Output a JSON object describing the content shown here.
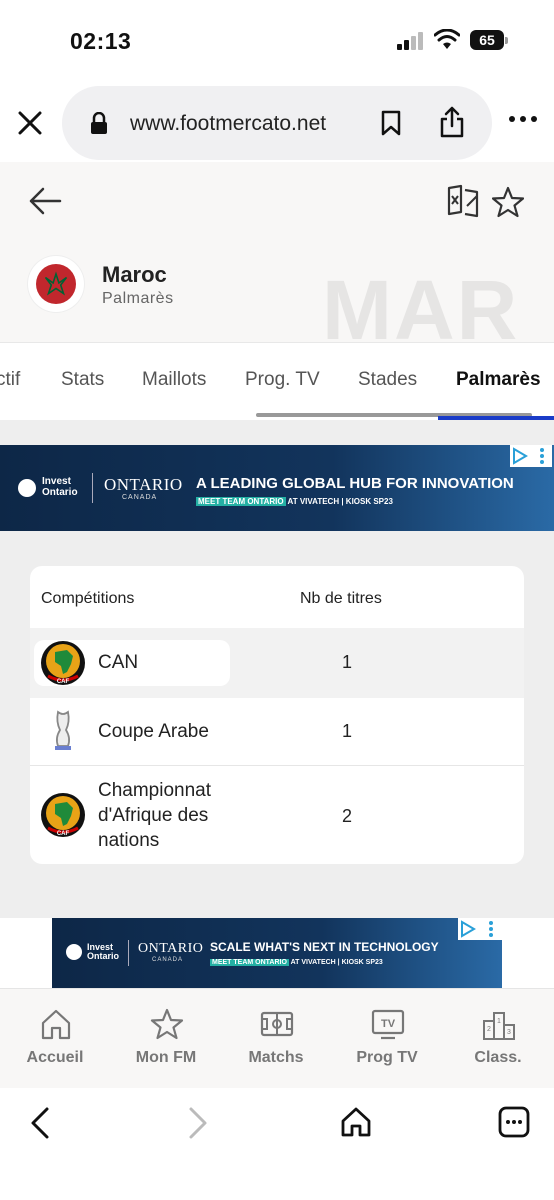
{
  "status_bar": {
    "time": "02:13",
    "battery": "65"
  },
  "browser": {
    "url": "www.footmercato.net"
  },
  "header": {
    "team_name": "Maroc",
    "subtitle": "Palmarès",
    "watermark": "MAR"
  },
  "tabs": [
    {
      "label": "ctif"
    },
    {
      "label": "Stats"
    },
    {
      "label": "Maillots"
    },
    {
      "label": "Prog. TV"
    },
    {
      "label": "Stades"
    },
    {
      "label": "Palmarès",
      "active": true
    }
  ],
  "ads": [
    {
      "brand_line1": "Invest",
      "brand_line2": "Ontario",
      "ontario": "ONTARIO",
      "canada": "CANADA",
      "headline": "A LEADING GLOBAL HUB FOR INNOVATION",
      "sub_highlight": "MEET TEAM ONTARIO",
      "sub_rest": " AT VIVATECH | KIOSK SP23"
    },
    {
      "brand_line1": "Invest",
      "brand_line2": "Ontario",
      "ontario": "ONTARIO",
      "canada": "CANADA",
      "headline": "SCALE WHAT'S NEXT IN TECHNOLOGY",
      "sub_highlight": "MEET TEAM ONTARIO",
      "sub_rest": " AT VIVATECH | KIOSK SP23"
    }
  ],
  "table": {
    "col_competitions": "Compétitions",
    "col_titles": "Nb de titres",
    "rows": [
      {
        "competition": "CAN",
        "titles": "1",
        "logo": "caf-logo"
      },
      {
        "competition": "Coupe Arabe",
        "titles": "1",
        "logo": "arab-cup-trophy"
      },
      {
        "competition": "Championnat d'Afrique des nations",
        "titles": "2",
        "logo": "caf-logo"
      }
    ]
  },
  "bottom_nav": [
    {
      "label": "Accueil",
      "icon": "home-icon"
    },
    {
      "label": "Mon FM",
      "icon": "star-icon"
    },
    {
      "label": "Matchs",
      "icon": "pitch-icon"
    },
    {
      "label": "Prog TV",
      "icon": "tv-icon"
    },
    {
      "label": "Class.",
      "icon": "podium-icon"
    }
  ],
  "colors": {
    "accent": "#1a3cc8",
    "flag_red": "#c1272d",
    "flag_green": "#006233"
  }
}
